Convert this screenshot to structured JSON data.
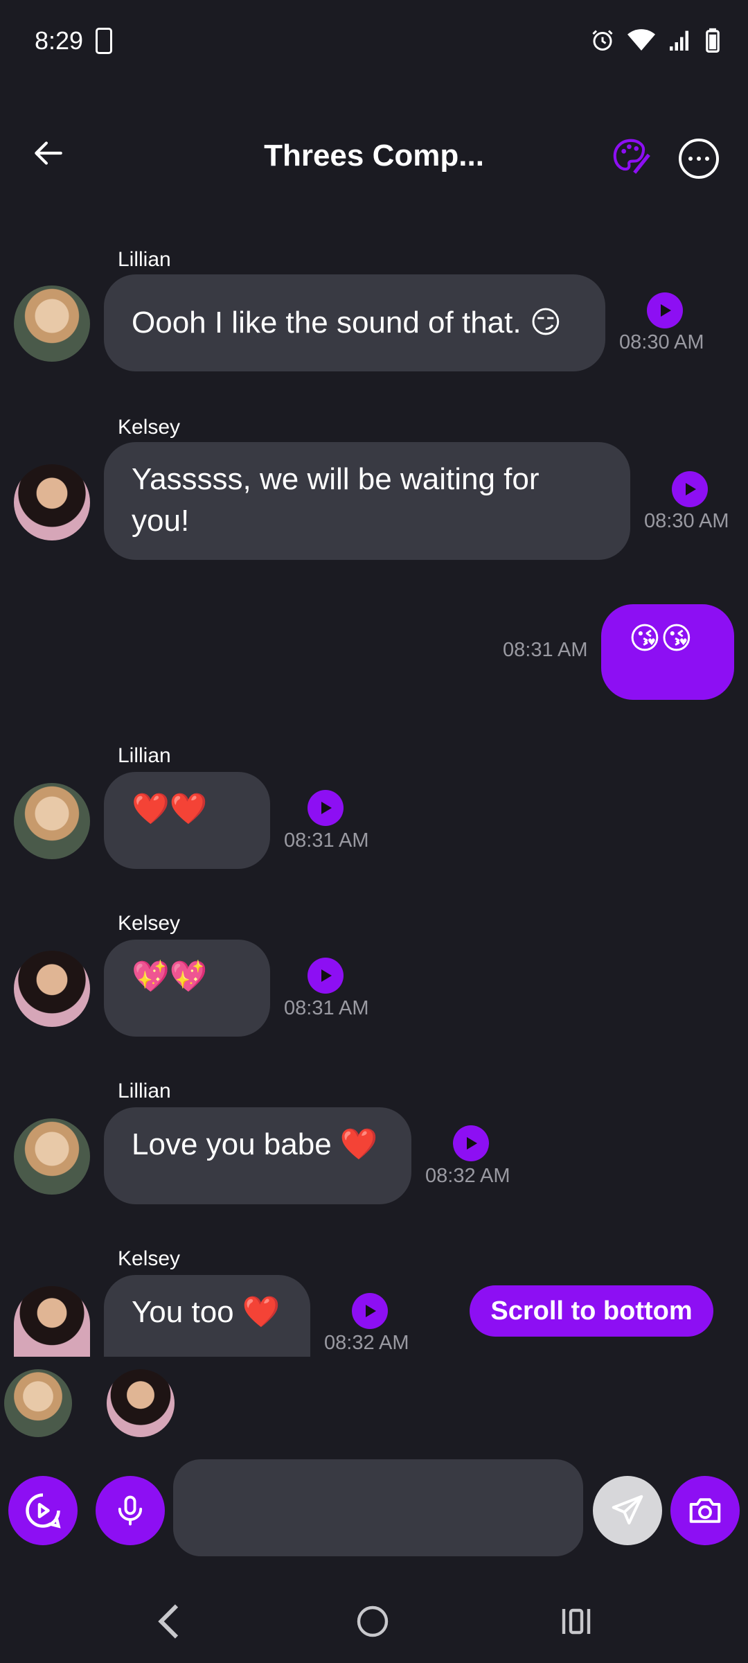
{
  "status": {
    "time": "8:29"
  },
  "header": {
    "title": "Threes Comp..."
  },
  "messages": [
    {
      "sender": "Lillian",
      "text": "Oooh I like the sound of that. 😏",
      "time": "08:30 AM"
    },
    {
      "sender": "Kelsey",
      "text": "Yasssss, we will be waiting for you!",
      "time": "08:30 AM"
    },
    {
      "sender": "",
      "text": "😘😘",
      "time": "08:31 AM"
    },
    {
      "sender": "Lillian",
      "text": "❤️❤️",
      "time": "08:31 AM"
    },
    {
      "sender": "Kelsey",
      "text": "💖💖",
      "time": "08:31 AM"
    },
    {
      "sender": "Lillian",
      "text": "Love you babe ❤️",
      "time": "08:32 AM"
    },
    {
      "sender": "Kelsey",
      "text": "You too ❤️",
      "time": "08:32 AM"
    }
  ],
  "scroll_button": {
    "label": "Scroll to bottom"
  },
  "composer": {
    "placeholder": ""
  },
  "colors": {
    "accent": "#8d0ff3",
    "bubble": "#393a43",
    "background": "#1b1b22"
  },
  "icons": [
    "back-arrow-icon",
    "palette-icon",
    "more-icon",
    "play-icon",
    "video-play-icon",
    "microphone-icon",
    "send-icon",
    "camera-icon"
  ]
}
